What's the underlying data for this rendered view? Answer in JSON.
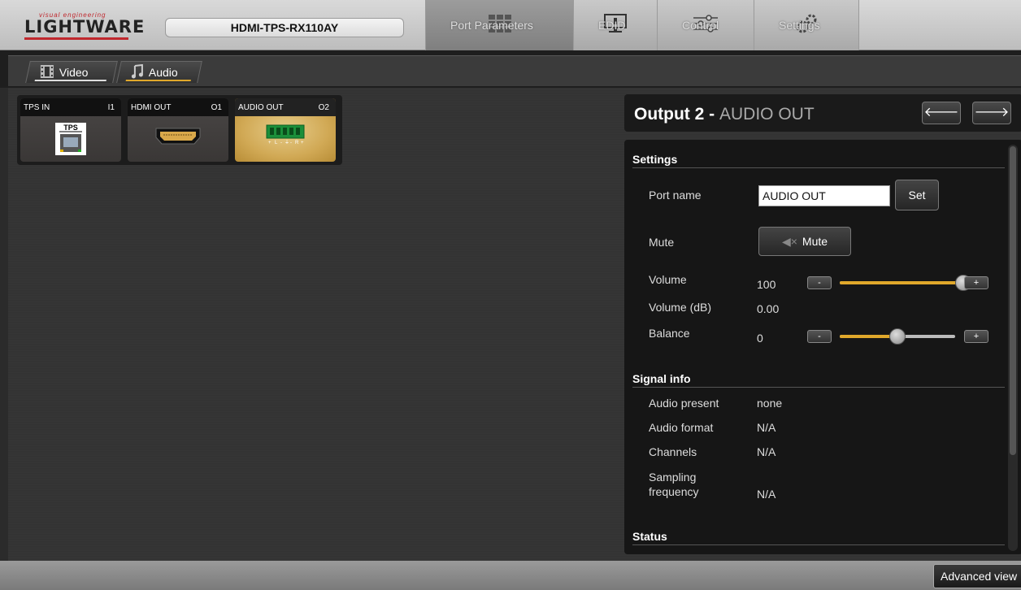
{
  "header": {
    "logo_tagline": "visual engineering",
    "logo_text": "LIGHTWARE",
    "device_name": "HDMI-TPS-RX110AY",
    "tabs": [
      {
        "label": "Port Parameters",
        "icon": "grid-icon",
        "active": true
      },
      {
        "label": "EDID",
        "icon": "monitor-icon",
        "active": false
      },
      {
        "label": "Control",
        "icon": "sliders-icon",
        "active": false
      },
      {
        "label": "Settings",
        "icon": "gears-icon",
        "active": false
      }
    ]
  },
  "subtabs": [
    {
      "label": "Video",
      "icon": "film-icon"
    },
    {
      "label": "Audio",
      "icon": "music-note-icon",
      "active": true
    }
  ],
  "ports": [
    {
      "name": "TPS IN",
      "id": "I1",
      "icon": "tps-connector-icon",
      "connector_label": "TPS"
    },
    {
      "name": "HDMI OUT",
      "id": "O1",
      "icon": "hdmi-connector-icon"
    },
    {
      "name": "AUDIO OUT",
      "id": "O2",
      "icon": "audio-terminal-icon",
      "selected": true
    }
  ],
  "panel": {
    "title": "Output 2 - ",
    "subtitle": "AUDIO OUT",
    "prev_label": "🡐",
    "next_label": "🡒",
    "settings": {
      "section_title": "Settings",
      "port_name_label": "Port name",
      "port_name_value": "AUDIO OUT",
      "set_label": "Set",
      "mute_label": "Mute",
      "mute_button_label": "Mute",
      "volume_label": "Volume",
      "volume_value": "100",
      "volume_level": 1.0,
      "volume_db_label": "Volume (dB)",
      "volume_db_value": "0.00",
      "balance_label": "Balance",
      "balance_value": "0",
      "balance_level": 0.5,
      "minus_label": "-",
      "plus_label": "+"
    },
    "signal_info": {
      "section_title": "Signal info",
      "rows": [
        {
          "label": "Audio present",
          "value": "none"
        },
        {
          "label": "Audio format",
          "value": "N/A"
        },
        {
          "label": "Channels",
          "value": "N/A"
        },
        {
          "label": "Sampling frequency",
          "value": "N/A"
        }
      ]
    },
    "status": {
      "section_title": "Status"
    }
  },
  "footer": {
    "advanced_view_label": "Advanced view"
  },
  "colors": {
    "accent": "#e0a82b",
    "brand_red": "#c0272d",
    "selected_port": "#d1a955"
  }
}
